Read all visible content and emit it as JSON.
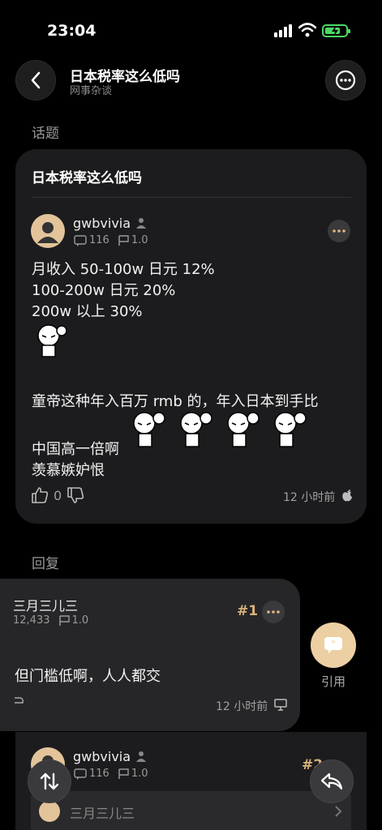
{
  "status_bar": {
    "time": "23:04"
  },
  "header": {
    "title": "日本税率这么低吗",
    "subtitle": "网事杂谈"
  },
  "topic_section_label": "话题",
  "topic": {
    "title": "日本税率这么低吗",
    "author": "gwbvivia",
    "posts_count": "116",
    "flag_level": "1.0",
    "lines": [
      "月收入 50-100w 日元 12%",
      "100-200w 日元 20%",
      "200w 以上 30%"
    ],
    "line4": "童帝这种年入百万 rmb 的，年入日本到手比",
    "line5": "中国高一倍啊",
    "line6": "羡慕嫉妒恨",
    "likes": "0",
    "time": "12 小时前"
  },
  "reply_section_label": "回复",
  "reply1": {
    "author": "三月三儿三",
    "posts_count": "12,433",
    "flag_level": "1.0",
    "floor": "#1",
    "text": "但门槛低啊，人人都交",
    "time": "12 小时前"
  },
  "quote_label": "引用",
  "reply2": {
    "author": "gwbvivia",
    "posts_count": "116",
    "flag_level": "1.0",
    "floor": "#2",
    "quoted_author": "三月三儿三"
  },
  "colors": {
    "background": "#000000",
    "card": "#1c1c1e",
    "accent": "#ecd0a4",
    "floor": "#d8b37c"
  }
}
